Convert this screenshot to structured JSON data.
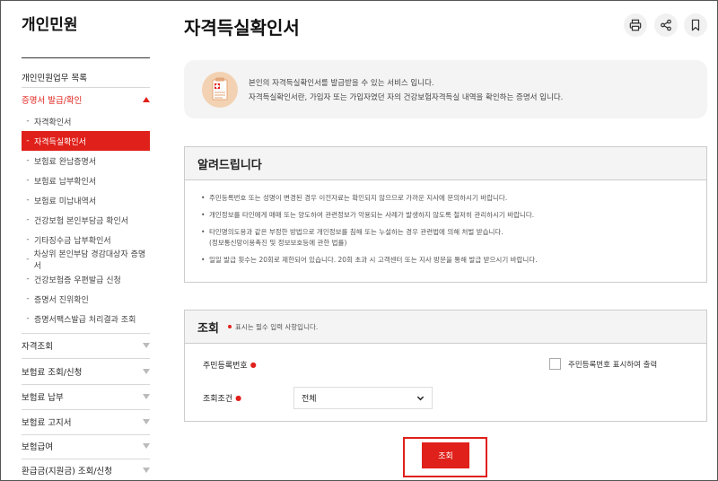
{
  "sidebar": {
    "title": "개인민원",
    "top_link": "개인민원업무 목록",
    "active_section": "증명서 발급/확인",
    "sub_items": [
      {
        "label": "자격확인서",
        "active": false
      },
      {
        "label": "자격득실확인서",
        "active": true
      },
      {
        "label": "보험료 완납증명서",
        "active": false
      },
      {
        "label": "보험료 납부확인서",
        "active": false
      },
      {
        "label": "보험료 미납내역서",
        "active": false
      },
      {
        "label": "건강보험 본인부담금 확인서",
        "active": false
      },
      {
        "label": "기타징수금 납부확인서",
        "active": false
      },
      {
        "label": "차상위 본인부담 경감대상자 증명서",
        "active": false
      },
      {
        "label": "건강보험증 우편발급 신청",
        "active": false
      },
      {
        "label": "증명서 진위확인",
        "active": false
      },
      {
        "label": "증명서팩스발급 처리결과 조회",
        "active": false
      }
    ],
    "sections": [
      "자격조회",
      "보험료 조회/신청",
      "보험료 납부",
      "보험료 고지서",
      "보험급여",
      "환급금(지원금) 조회/신청"
    ]
  },
  "page": {
    "title": "자격득실확인서"
  },
  "toolbar": {
    "icons": [
      "print-icon",
      "share-icon",
      "bookmark-icon"
    ]
  },
  "info": {
    "line1": "본인의 자격득실확인서를 발급받을 수 있는 서비스 입니다.",
    "line2": "자격득실확인서란, 가입자 또는 가입자였던 자의 건강보험자격득실 내역을 확인하는 증명서 입니다."
  },
  "notice": {
    "title": "알려드립니다",
    "items": [
      {
        "text": "주민등록번호 또는 성명이 변경된 경우 이전자료는 확인되지 않으므로 가까운 지사에 문의하시기 바랍니다.",
        "sub": ""
      },
      {
        "text": "개인정보를 타인에게 매매 또는 양도하여 관련정보가 악용되는 사례가 발생하지 않도록 철저히 관리하시기 바랍니다.",
        "sub": ""
      },
      {
        "text": "타인명의도용과 같은 부정한 방법으로 개인정보를 침해 또는 누설하는 경우 관련법에 의해 처벌 받습니다.",
        "sub": "(정보통신망이용촉진 및 정보보호등에 관한 법률)"
      },
      {
        "text": "일일 발급 횟수는 20회로 제한되어 있습니다. 20회 초과 시 고객센터 또는 지사 방문을 통해 발급 받으시기 바랍니다.",
        "sub": ""
      }
    ]
  },
  "query": {
    "title": "조회",
    "required_note": "표시는 필수 입력 사항입니다.",
    "rrn_label": "주민등록번호",
    "rrn_checkbox_label": "주민등록번호 표시하여 출력",
    "condition_label": "조회조건",
    "condition_value": "전체",
    "submit_label": "조회"
  },
  "colors": {
    "accent": "#e0201a",
    "panel_bg": "#f4f4f4"
  }
}
